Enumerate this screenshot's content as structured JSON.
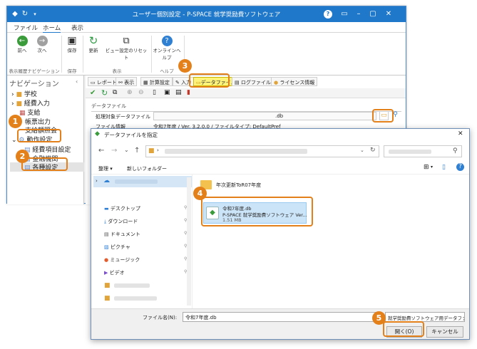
{
  "window": {
    "title": "ユーザー個別設定 - P-SPACE 就学奨励費ソフトウェア",
    "help": "?"
  },
  "menu": {
    "file": "ファイル",
    "home": "ホーム",
    "view": "表示"
  },
  "ribbon": {
    "forward": "次へ",
    "back": "前へ",
    "save": "保存",
    "refresh": "更新",
    "reset_view": "ビュー設定のリセット",
    "online_help": "オンラインヘルプ",
    "groups": {
      "nav_history": "表示履歴ナビゲーション",
      "save": "保存",
      "view": "表示",
      "help": "ヘルプ"
    }
  },
  "nav": {
    "header": "ナビゲーション",
    "items": [
      "学校",
      "経費入力",
      "支給",
      "帳票出力",
      "支給額照会",
      "動作設定",
      "経費項目設定",
      "金融機関",
      "各種設定"
    ]
  },
  "tabs": [
    "レポート",
    "表示",
    "計算設定",
    "入力",
    "データファイル",
    "ログファイル",
    "ライセンス情報"
  ],
  "panel": {
    "section": "データファイル",
    "target_label": "処理対象データファイル",
    "target_value": ".db",
    "info_label": "ファイル情報",
    "info_value": "令和7年度 / Ver. 3.2.0.0 / ファイルタイプ: DefaultPref"
  },
  "dialog": {
    "title": "データファイルを指定",
    "organize": "整理 ▾",
    "new_folder": "新しいフォルダー",
    "places": [
      "デスクトップ",
      "ダウンロード",
      "ドキュメント",
      "ピクチャ",
      "ミュージック",
      "ビデオ"
    ],
    "folder": "年次更新ToR07年度",
    "file": {
      "name": "令和7年度.db",
      "type": "P-SPACE 就学奨励費ソフトウェア Ver...",
      "size": "1.51 MB"
    },
    "filename_label": "ファイル名(N):",
    "filename_value": "令和7年度.db",
    "filter": "就学奨励費ソフトウェア用データファ",
    "open": "開く(O)",
    "cancel": "キャンセル"
  },
  "badges": [
    "1",
    "2",
    "3",
    "4",
    "5"
  ],
  "colors": {
    "accent": "#e4801a",
    "titlebar": "#1f78c9"
  }
}
